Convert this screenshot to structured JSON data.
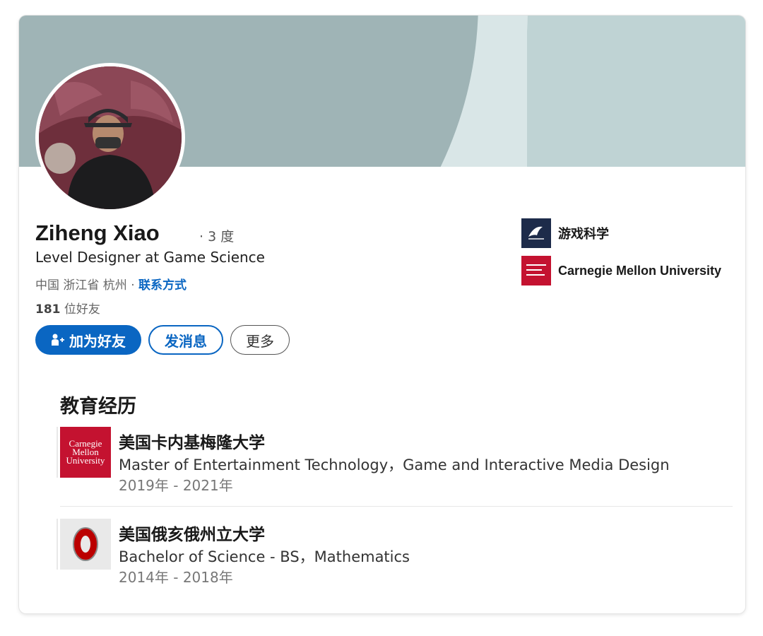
{
  "profile": {
    "name": "Ziheng Xiao",
    "degree": "· 3 度",
    "headline": "Level Designer at Game Science",
    "location": "中国 浙江省 杭州 · ",
    "contact_link": "联系方式",
    "friends_count": "181",
    "friends_label": " 位好友"
  },
  "actions": {
    "add_friend": "加为好友",
    "message": "发消息",
    "more": "更多"
  },
  "orgs": [
    {
      "name": "游戏科学",
      "icon": "game-science-logo"
    },
    {
      "name": "Carnegie Mellon University",
      "icon": "cmu-logo"
    }
  ],
  "education": {
    "title": "教育经历",
    "items": [
      {
        "school": "美国卡内基梅隆大学",
        "degree": "Master of Entertainment Technology，Game and Interactive Media Design",
        "dates": "2019年 - 2021年",
        "logo_text": [
          "Carnegie",
          "Mellon",
          "University"
        ]
      },
      {
        "school": "美国俄亥俄州立大学",
        "degree": "Bachelor of Science - BS，Mathematics",
        "dates": "2014年 - 2018年"
      }
    ]
  },
  "colors": {
    "brand_blue": "#0a66c2",
    "banner_dark": "#9fb4b6",
    "banner_light": "#bfd3d4",
    "cmu_red": "#c41230",
    "osu_red": "#bb0000"
  }
}
